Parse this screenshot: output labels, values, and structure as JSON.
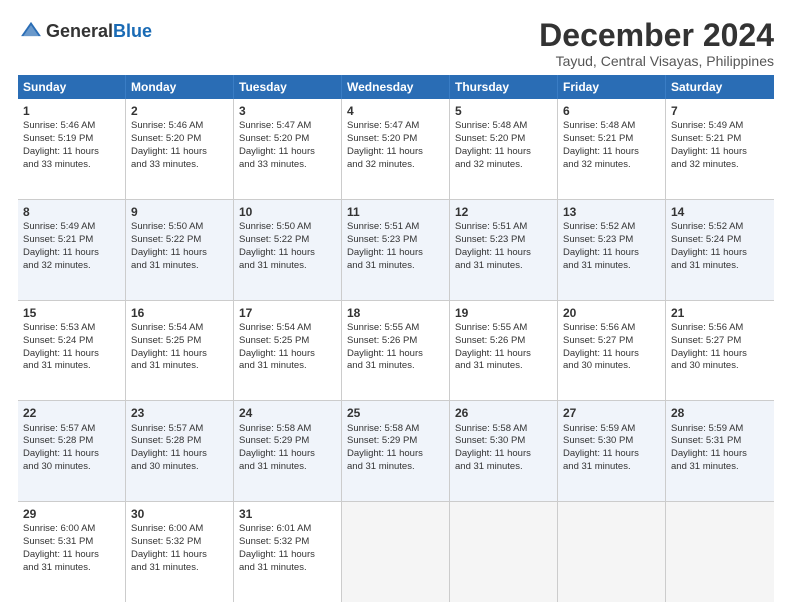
{
  "logo": {
    "general": "General",
    "blue": "Blue"
  },
  "title": "December 2024",
  "location": "Tayud, Central Visayas, Philippines",
  "days_of_week": [
    "Sunday",
    "Monday",
    "Tuesday",
    "Wednesday",
    "Thursday",
    "Friday",
    "Saturday"
  ],
  "weeks": [
    [
      {
        "day": "1",
        "sunrise": "5:46 AM",
        "sunset": "5:19 PM",
        "daylight": "11 hours and 33 minutes."
      },
      {
        "day": "2",
        "sunrise": "5:46 AM",
        "sunset": "5:20 PM",
        "daylight": "11 hours and 33 minutes."
      },
      {
        "day": "3",
        "sunrise": "5:47 AM",
        "sunset": "5:20 PM",
        "daylight": "11 hours and 33 minutes."
      },
      {
        "day": "4",
        "sunrise": "5:47 AM",
        "sunset": "5:20 PM",
        "daylight": "11 hours and 32 minutes."
      },
      {
        "day": "5",
        "sunrise": "5:48 AM",
        "sunset": "5:20 PM",
        "daylight": "11 hours and 32 minutes."
      },
      {
        "day": "6",
        "sunrise": "5:48 AM",
        "sunset": "5:21 PM",
        "daylight": "11 hours and 32 minutes."
      },
      {
        "day": "7",
        "sunrise": "5:49 AM",
        "sunset": "5:21 PM",
        "daylight": "11 hours and 32 minutes."
      }
    ],
    [
      {
        "day": "8",
        "sunrise": "5:49 AM",
        "sunset": "5:21 PM",
        "daylight": "11 hours and 32 minutes."
      },
      {
        "day": "9",
        "sunrise": "5:50 AM",
        "sunset": "5:22 PM",
        "daylight": "11 hours and 31 minutes."
      },
      {
        "day": "10",
        "sunrise": "5:50 AM",
        "sunset": "5:22 PM",
        "daylight": "11 hours and 31 minutes."
      },
      {
        "day": "11",
        "sunrise": "5:51 AM",
        "sunset": "5:23 PM",
        "daylight": "11 hours and 31 minutes."
      },
      {
        "day": "12",
        "sunrise": "5:51 AM",
        "sunset": "5:23 PM",
        "daylight": "11 hours and 31 minutes."
      },
      {
        "day": "13",
        "sunrise": "5:52 AM",
        "sunset": "5:23 PM",
        "daylight": "11 hours and 31 minutes."
      },
      {
        "day": "14",
        "sunrise": "5:52 AM",
        "sunset": "5:24 PM",
        "daylight": "11 hours and 31 minutes."
      }
    ],
    [
      {
        "day": "15",
        "sunrise": "5:53 AM",
        "sunset": "5:24 PM",
        "daylight": "11 hours and 31 minutes."
      },
      {
        "day": "16",
        "sunrise": "5:54 AM",
        "sunset": "5:25 PM",
        "daylight": "11 hours and 31 minutes."
      },
      {
        "day": "17",
        "sunrise": "5:54 AM",
        "sunset": "5:25 PM",
        "daylight": "11 hours and 31 minutes."
      },
      {
        "day": "18",
        "sunrise": "5:55 AM",
        "sunset": "5:26 PM",
        "daylight": "11 hours and 31 minutes."
      },
      {
        "day": "19",
        "sunrise": "5:55 AM",
        "sunset": "5:26 PM",
        "daylight": "11 hours and 31 minutes."
      },
      {
        "day": "20",
        "sunrise": "5:56 AM",
        "sunset": "5:27 PM",
        "daylight": "11 hours and 30 minutes."
      },
      {
        "day": "21",
        "sunrise": "5:56 AM",
        "sunset": "5:27 PM",
        "daylight": "11 hours and 30 minutes."
      }
    ],
    [
      {
        "day": "22",
        "sunrise": "5:57 AM",
        "sunset": "5:28 PM",
        "daylight": "11 hours and 30 minutes."
      },
      {
        "day": "23",
        "sunrise": "5:57 AM",
        "sunset": "5:28 PM",
        "daylight": "11 hours and 30 minutes."
      },
      {
        "day": "24",
        "sunrise": "5:58 AM",
        "sunset": "5:29 PM",
        "daylight": "11 hours and 31 minutes."
      },
      {
        "day": "25",
        "sunrise": "5:58 AM",
        "sunset": "5:29 PM",
        "daylight": "11 hours and 31 minutes."
      },
      {
        "day": "26",
        "sunrise": "5:58 AM",
        "sunset": "5:30 PM",
        "daylight": "11 hours and 31 minutes."
      },
      {
        "day": "27",
        "sunrise": "5:59 AM",
        "sunset": "5:30 PM",
        "daylight": "11 hours and 31 minutes."
      },
      {
        "day": "28",
        "sunrise": "5:59 AM",
        "sunset": "5:31 PM",
        "daylight": "11 hours and 31 minutes."
      }
    ],
    [
      {
        "day": "29",
        "sunrise": "6:00 AM",
        "sunset": "5:31 PM",
        "daylight": "11 hours and 31 minutes."
      },
      {
        "day": "30",
        "sunrise": "6:00 AM",
        "sunset": "5:32 PM",
        "daylight": "11 hours and 31 minutes."
      },
      {
        "day": "31",
        "sunrise": "6:01 AM",
        "sunset": "5:32 PM",
        "daylight": "11 hours and 31 minutes."
      },
      null,
      null,
      null,
      null
    ]
  ],
  "labels": {
    "sunrise": "Sunrise:",
    "sunset": "Sunset:",
    "daylight": "Daylight:"
  }
}
